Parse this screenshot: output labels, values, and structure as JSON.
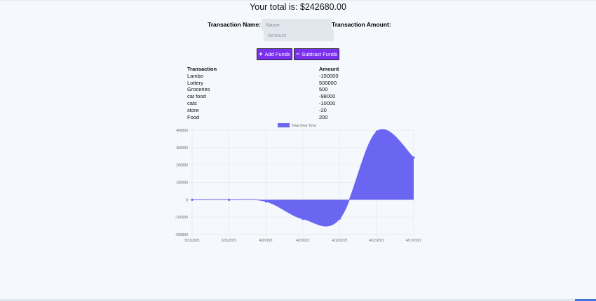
{
  "header": {
    "total_text": "Your total is: $242680.00"
  },
  "form": {
    "name_label": "Transaction Name:",
    "amount_label": "Transaction Amount:",
    "name_placeholder": "Name",
    "amount_placeholder": "Amount",
    "add_label": "Add Funds",
    "subtract_label": "Subtract Funds",
    "add_icon": "plus-icon",
    "subtract_icon": "minus-icon",
    "button_color": "#7b2ff0"
  },
  "table": {
    "headers": [
      "Transaction",
      "Amount"
    ],
    "rows": [
      [
        "Lambo",
        "-150000"
      ],
      [
        "Lottery",
        "500000"
      ],
      [
        "Groceries",
        "500"
      ],
      [
        "cat food",
        "-98000"
      ],
      [
        "cats",
        "-10000"
      ],
      [
        "store",
        "-20"
      ],
      [
        "Food",
        "200"
      ]
    ]
  },
  "chart_data": {
    "type": "area",
    "legend": "Total Over Time",
    "legend_position": "top",
    "color": "#6b66f2",
    "categories": [
      "3/31/2021",
      "3/31/2021",
      "4/2/2021",
      "4/2/2021",
      "4/12/2021",
      "4/12/2021",
      "4/12/2021"
    ],
    "values": [
      0,
      0,
      -10000,
      -110000,
      -108000,
      392000,
      242680
    ],
    "ylim": [
      -200000,
      400000
    ],
    "yticks": [
      "400000",
      "300000",
      "200000",
      "100000",
      "0",
      "-100000",
      "-200000"
    ],
    "grid": true
  }
}
